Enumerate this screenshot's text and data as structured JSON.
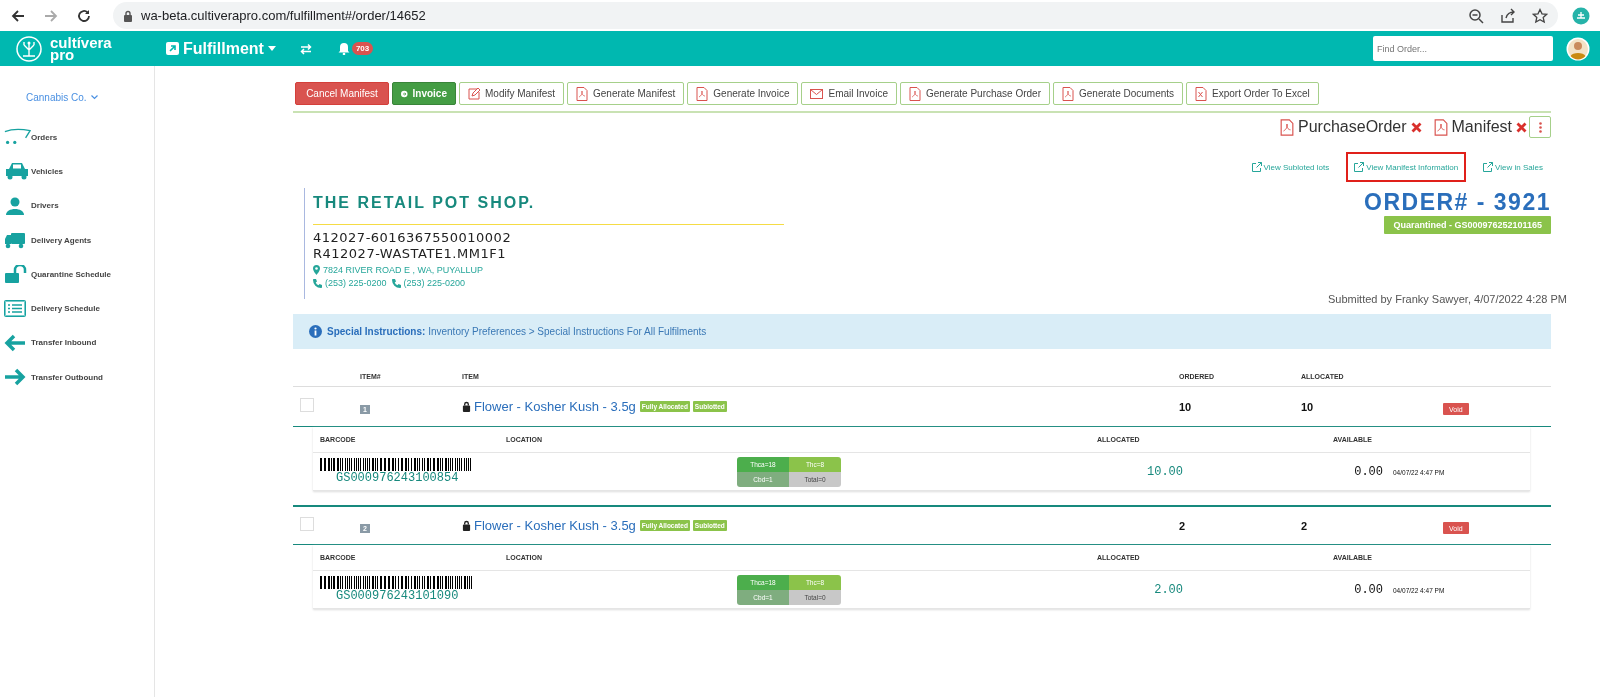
{
  "browser": {
    "url": "wa-beta.cultiverapro.com/fulfillment#/order/14652"
  },
  "header": {
    "logo": [
      "cultívera",
      "pro"
    ],
    "module": "Fulfillment",
    "notifications": "703",
    "search": {
      "placeholder": "Find Order..."
    }
  },
  "sidebar": {
    "company": "Cannabis Co.",
    "items": [
      {
        "label": "Orders",
        "kind": "cart"
      },
      {
        "label": "Vehicles",
        "kind": "car"
      },
      {
        "label": "Drivers",
        "kind": "user"
      },
      {
        "label": "Delivery Agents",
        "kind": "truck"
      },
      {
        "label": "Quarantine Schedule",
        "kind": "unlock"
      },
      {
        "label": "Delivery Schedule",
        "kind": "list"
      },
      {
        "label": "Transfer Inbound",
        "kind": "left"
      },
      {
        "label": "Transfer Outbound",
        "kind": "right"
      }
    ]
  },
  "toolbar": [
    {
      "label": "Cancel Manifest",
      "kind": "danger"
    },
    {
      "label": "Invoice",
      "kind": "success"
    },
    {
      "label": "Modify Manifest",
      "kind": "edit"
    },
    {
      "label": "Generate Manifest",
      "kind": "pdf"
    },
    {
      "label": "Generate Invoice",
      "kind": "pdf"
    },
    {
      "label": "Email Invoice",
      "kind": "mail"
    },
    {
      "label": "Generate Purchase Order",
      "kind": "pdf"
    },
    {
      "label": "Generate Documents",
      "kind": "pdf"
    },
    {
      "label": "Export Order To Excel",
      "kind": "excel"
    }
  ],
  "documents": [
    {
      "label": "PurchaseOrder"
    },
    {
      "label": "Manifest"
    }
  ],
  "links": [
    {
      "label": "View Subloted lots",
      "highlighted": false
    },
    {
      "label": "View Manifest Information",
      "highlighted": true
    },
    {
      "label": "View in Sales",
      "highlighted": false
    }
  ],
  "store": {
    "name": "THE RETAIL POT SHOP.",
    "license": "412027-6016367550010002",
    "location_id": "R412027-WASTATE1.MM1F1",
    "address": "7824 RIVER ROAD E , WA, PUYALLUP",
    "phones": [
      "(253) 225-0200",
      "(253) 225-0200"
    ]
  },
  "order": {
    "number": "ORDER# - 3921",
    "status": "Quarantined - GS000976252101165",
    "submitted": "Submitted by Franky Sawyer, 4/07/2022 4:28 PM"
  },
  "special_instructions": {
    "label": "Special Instructions:",
    "text": "Inventory Preferences > Special Instructions For All Fulfilments"
  },
  "items_table": {
    "columns": [
      "ITEM#",
      "ITEM",
      "ORDERED",
      "ALLOCATED"
    ],
    "rows": [
      {
        "checked": false,
        "number": "1",
        "name": "Flower - Kosher Kush - 3.5g",
        "tags": [
          "Fully Allocated",
          "Sublotted"
        ],
        "ordered": "10",
        "allocated": "10",
        "action": "Void",
        "lot_columns": [
          "BARCODE",
          "LOCATION",
          "ALLOCATED",
          "AVAILABLE"
        ],
        "lots": [
          {
            "barcode": "GS000976243100854",
            "potency": [
              {
                "label": "Thca=18",
                "color": "#4cae4c"
              },
              {
                "label": "Thc=8",
                "color": "#8bc34a"
              },
              {
                "label": "Cbd=1",
                "color": "#7fad7f"
              },
              {
                "label": "Total=0",
                "color": "#c8c8c8"
              }
            ],
            "allocated": "10.00",
            "available": "0.00",
            "date": "04/07/22 4:47 PM"
          }
        ]
      },
      {
        "checked": false,
        "number": "2",
        "name": "Flower - Kosher Kush - 3.5g",
        "tags": [
          "Fully Allocated",
          "Sublotted"
        ],
        "ordered": "2",
        "allocated": "2",
        "action": "Void",
        "lot_columns": [
          "BARCODE",
          "LOCATION",
          "ALLOCATED",
          "AVAILABLE"
        ],
        "lots": [
          {
            "barcode": "GS000976243101090",
            "potency": [
              {
                "label": "Thca=18",
                "color": "#4cae4c"
              },
              {
                "label": "Thc=8",
                "color": "#8bc34a"
              },
              {
                "label": "Cbd=1",
                "color": "#7fad7f"
              },
              {
                "label": "Total=0",
                "color": "#c8c8c8"
              }
            ],
            "allocated": "2.00",
            "available": "0.00",
            "date": "04/07/22 4:47 PM"
          }
        ]
      }
    ]
  }
}
